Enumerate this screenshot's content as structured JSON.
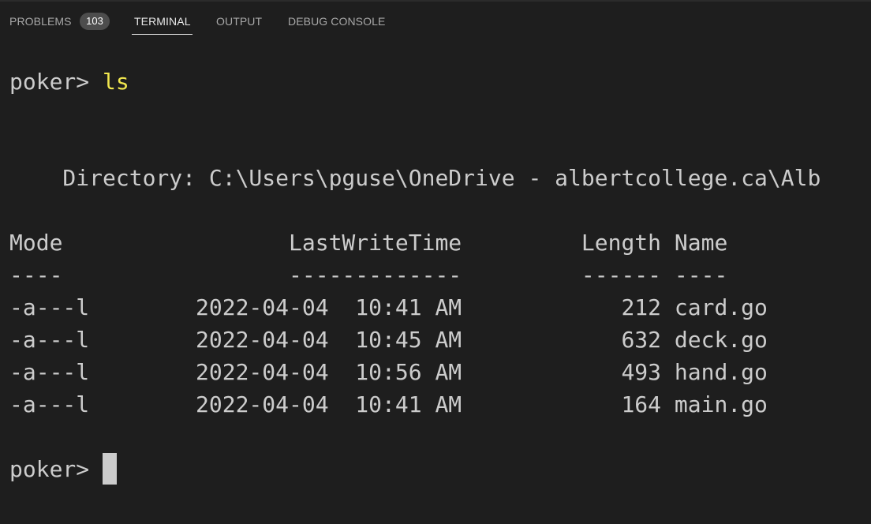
{
  "tabs": [
    {
      "label": "PROBLEMS",
      "badge": "103"
    },
    {
      "label": "TERMINAL",
      "active": true
    },
    {
      "label": "OUTPUT"
    },
    {
      "label": "DEBUG CONSOLE"
    }
  ],
  "terminal": {
    "prompt1": "poker> ",
    "command1": "ls",
    "directory_line": "    Directory: C:\\Users\\pguse\\OneDrive - albertcollege.ca\\Alb",
    "header": "Mode                 LastWriteTime         Length Name",
    "separator": "----                 -------------         ------ ----",
    "rows": [
      "-a---l        2022-04-04  10:41 AM            212 card.go",
      "-a---l        2022-04-04  10:45 AM            632 deck.go",
      "-a---l        2022-04-04  10:56 AM            493 hand.go",
      "-a---l        2022-04-04  10:41 AM            164 main.go"
    ],
    "prompt2": "poker> "
  },
  "colors": {
    "background": "#1e1e1e",
    "text": "#cccccc",
    "command": "#f0e64e"
  }
}
